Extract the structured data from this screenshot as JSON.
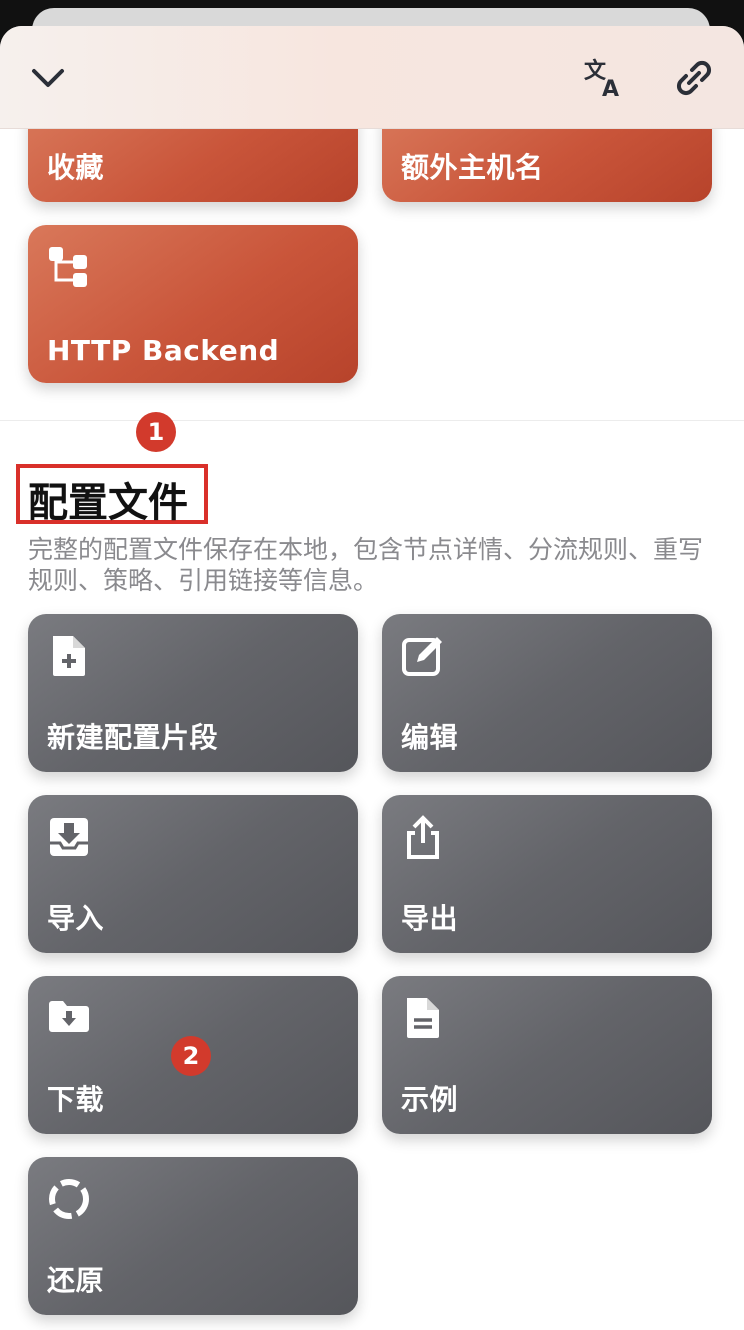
{
  "topbar": {
    "collapse_icon": "chevron-down-icon",
    "translate_icon": "translate-icon",
    "link_icon": "link-icon"
  },
  "top_cards": [
    {
      "label": "收藏"
    },
    {
      "label": "额外主机名"
    },
    {
      "label": "HTTP Backend",
      "icon": "hierarchy-icon"
    }
  ],
  "section": {
    "badge_1": "1",
    "title": "配置文件",
    "description": "完整的配置文件保存在本地，包含节点详情、分流规则、重写规则、策略、引用链接等信息。"
  },
  "profile_cards": [
    {
      "label": "新建配置片段",
      "icon": "file-plus-icon"
    },
    {
      "label": "编辑",
      "icon": "edit-icon"
    },
    {
      "label": "导入",
      "icon": "inbox-import-icon"
    },
    {
      "label": "导出",
      "icon": "share-icon"
    },
    {
      "label": "下载",
      "icon": "folder-download-icon"
    },
    {
      "label": "示例",
      "icon": "document-icon"
    },
    {
      "label": "还原",
      "icon": "restore-icon"
    }
  ],
  "badge_2": "2",
  "colors": {
    "orange_card": "#c9553a",
    "gray_card": "#636469",
    "highlight": "#d9302a",
    "badge": "#d23a2c"
  }
}
